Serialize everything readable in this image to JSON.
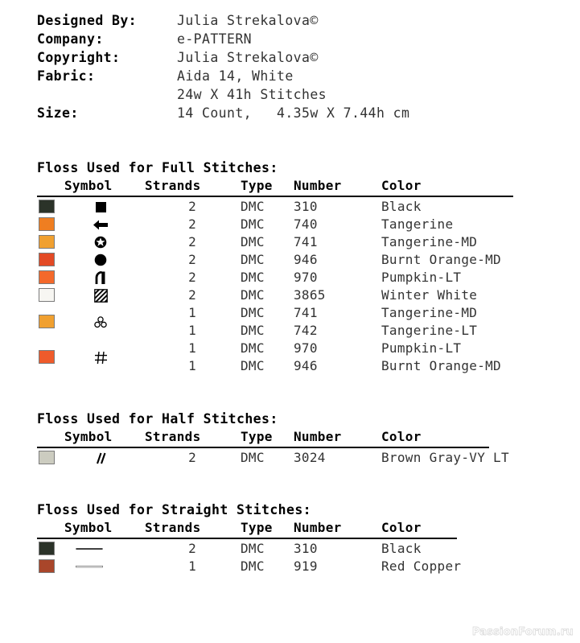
{
  "document": {
    "info_rows": [
      {
        "label": "Designed By:",
        "value": "Julia Strekalova©"
      },
      {
        "label": "Company:",
        "value": "e-PATTERN"
      },
      {
        "label": "Copyright:",
        "value": "Julia Strekalova©"
      },
      {
        "label": "Fabric:",
        "value": "Aida 14, White"
      },
      {
        "label": "",
        "value": "24w X 41h Stitches"
      },
      {
        "label": "Size:",
        "value": "14 Count,   4.35w X 7.44h cm"
      }
    ]
  },
  "columns": {
    "symbol": "Symbol",
    "strands": "Strands",
    "type": "Type",
    "number": "Number",
    "color": "Color"
  },
  "full_stitches": {
    "title": "Floss Used for Full Stitches:",
    "rows": [
      {
        "strands": "2",
        "type": "DMC",
        "number": "310",
        "color": "Black",
        "swatch": "#2b3329",
        "symbol": "filled-square-icon"
      },
      {
        "strands": "2",
        "type": "DMC",
        "number": "740",
        "color": "Tangerine",
        "swatch": "#ef7e21",
        "symbol": "left-arrow-icon"
      },
      {
        "strands": "2",
        "type": "DMC",
        "number": "741",
        "color": "Tangerine-MD",
        "swatch": "#f0a030",
        "symbol": "star-in-circle-icon"
      },
      {
        "strands": "2",
        "type": "DMC",
        "number": "946",
        "color": "Burnt Orange-MD",
        "swatch": "#e34a25",
        "symbol": "filled-circle-icon"
      },
      {
        "strands": "2",
        "type": "DMC",
        "number": "970",
        "color": "Pumpkin-LT",
        "swatch": "#f4692b",
        "symbol": "quarter-moon-icon"
      },
      {
        "strands": "2",
        "type": "DMC",
        "number": "3865",
        "color": "Winter White",
        "swatch": "#f7f6f2",
        "symbol": "hatched-square-icon"
      },
      {
        "strands": "1",
        "type": "DMC",
        "number": "741",
        "color": "Tangerine-MD",
        "swatch": "#f0a030",
        "symbol": "three-circles-icon",
        "blend_span": 2
      },
      {
        "strands": "1",
        "type": "DMC",
        "number": "742",
        "color": "Tangerine-LT",
        "swatch": "",
        "symbol": ""
      },
      {
        "strands": "1",
        "type": "DMC",
        "number": "970",
        "color": "Pumpkin-LT",
        "swatch": "#ef5b2b",
        "symbol": "hash-icon",
        "blend_span": 2
      },
      {
        "strands": "1",
        "type": "DMC",
        "number": "946",
        "color": "Burnt Orange-MD",
        "swatch": "",
        "symbol": ""
      }
    ]
  },
  "half_stitches": {
    "title": "Floss Used for Half Stitches:",
    "rows": [
      {
        "strands": "2",
        "type": "DMC",
        "number": "3024",
        "color": "Brown Gray-VY LT",
        "swatch": "#ccccc0",
        "symbol": "double-slash-icon"
      }
    ]
  },
  "straight_stitches": {
    "title": "Floss Used for Straight Stitches:",
    "rows": [
      {
        "strands": "2",
        "type": "DMC",
        "number": "310",
        "color": "Black",
        "swatch": "#2b3329",
        "symbol": "thick-line-icon"
      },
      {
        "strands": "1",
        "type": "DMC",
        "number": "919",
        "color": "Red Copper",
        "swatch": "#a9462a",
        "symbol": "thin-line-icon"
      }
    ]
  },
  "watermark": {
    "text": "PassionForum.ru"
  }
}
